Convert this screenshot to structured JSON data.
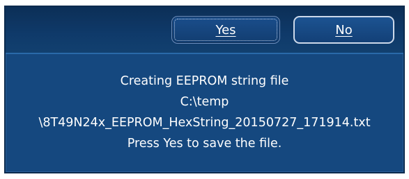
{
  "dialog": {
    "buttons": {
      "yes_label": "Yes",
      "no_label": "No"
    },
    "message_lines": [
      "Creating EEPROM string file",
      "C:\\temp",
      "\\8T49N24x_EEPROM_HexString_20150727_171914.txt",
      "Press Yes to save the file."
    ]
  },
  "colors": {
    "dialog_background": "#15487f",
    "button_bar": "#0f3a6a",
    "text": "#ffffff"
  }
}
